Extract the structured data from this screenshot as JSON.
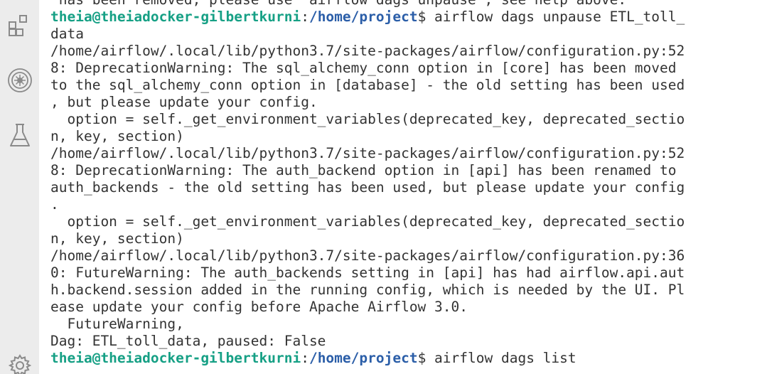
{
  "activity_bar": {
    "items": [
      {
        "name": "extensions-icon"
      },
      {
        "name": "airflow-icon"
      },
      {
        "name": "flask-icon"
      },
      {
        "name": "settings-gear-icon"
      }
    ]
  },
  "colors": {
    "prompt_user": "#16a085",
    "prompt_path": "#2b5ea8",
    "text": "#333333",
    "activity_bg": "#ececec"
  },
  "terminal": {
    "lines": [
      {
        "text": " has been removed, please use `airflow dags unpause`, see help above."
      },
      {
        "prompt": {
          "user": "theia@theiadocker-gilbertkurni",
          "colon": ":",
          "path": "/home/project",
          "cmd": "$ airflow dags unpause ETL_toll_"
        }
      },
      {
        "text": "data"
      },
      {
        "text": "/home/airflow/.local/lib/python3.7/site-packages/airflow/configuration.py:52"
      },
      {
        "text": "8: DeprecationWarning: The sql_alchemy_conn option in [core] has been moved"
      },
      {
        "text": "to the sql_alchemy_conn option in [database] - the old setting has been used"
      },
      {
        "text": ", but please update your config."
      },
      {
        "text": "  option = self._get_environment_variables(deprecated_key, deprecated_sectio"
      },
      {
        "text": "n, key, section)"
      },
      {
        "text": "/home/airflow/.local/lib/python3.7/site-packages/airflow/configuration.py:52"
      },
      {
        "text": "8: DeprecationWarning: The auth_backend option in [api] has been renamed to"
      },
      {
        "text": "auth_backends - the old setting has been used, but please update your config"
      },
      {
        "text": "."
      },
      {
        "text": "  option = self._get_environment_variables(deprecated_key, deprecated_sectio"
      },
      {
        "text": "n, key, section)"
      },
      {
        "text": "/home/airflow/.local/lib/python3.7/site-packages/airflow/configuration.py:36"
      },
      {
        "text": "0: FutureWarning: The auth_backends setting in [api] has had airflow.api.aut"
      },
      {
        "text": "h.backend.session added in the running config, which is needed by the UI. Pl"
      },
      {
        "text": "ease update your config before Apache Airflow 3.0."
      },
      {
        "text": "  FutureWarning,"
      },
      {
        "text": "Dag: ETL_toll_data, paused: False"
      },
      {
        "prompt": {
          "user": "theia@theiadocker-gilbertkurni",
          "colon": ":",
          "path": "/home/project",
          "cmd": "$ airflow dags list"
        }
      }
    ]
  }
}
